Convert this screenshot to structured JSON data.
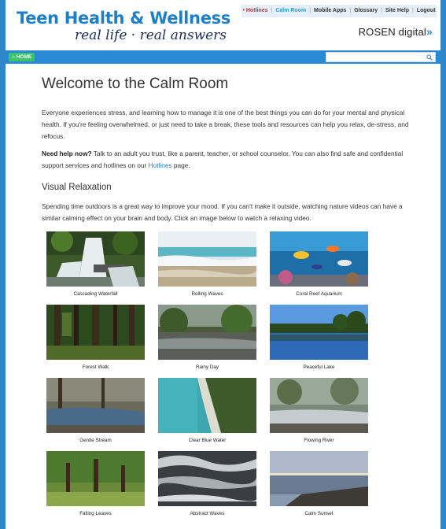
{
  "header": {
    "brand_title": "Teen Health & Wellness",
    "brand_tagline": "real life · real answers",
    "publisher_name": "ROSEN digital",
    "publisher_chevrons": "»",
    "topnav": {
      "hotlines": "• Hotlines",
      "calm_room": "Calm Room",
      "mobile_apps": "Mobile Apps",
      "glossary": "Glossary",
      "site_help": "Site Help",
      "logout": "Logout",
      "separator": "|"
    }
  },
  "navbar": {
    "home_label": "⌂ HOME",
    "search_placeholder": "",
    "search_icon": "search-icon"
  },
  "main": {
    "title": "Welcome to the Calm Room",
    "intro": "Everyone experiences stress, and learning how to manage it is one of the best things you can do for your mental and physical health. If you're feeling overwhelmed, or just need to take a break, these tools and resources can help you relax, de-stress, and refocus.",
    "help_bold": "Need help now?",
    "help_text": " Talk to an adult you trust, like a parent, teacher, or school counselor. You can also find safe and confidential support services and hotlines on our ",
    "help_link": "Hotlines",
    "help_end": " page.",
    "section_title": "Visual Relaxation",
    "section_text": "Spending time outdoors is a great way to improve your mood. If you can't make it outside, watching nature videos can have a similar calming effect on your brain and body. Click an image below to watch a relaxing video.",
    "videos": [
      {
        "caption": "Cascading Waterfall"
      },
      {
        "caption": "Rolling Waves"
      },
      {
        "caption": "Coral Reef Aquarium"
      },
      {
        "caption": "Forest Walk"
      },
      {
        "caption": "Rainy Day"
      },
      {
        "caption": "Peaceful Lake"
      },
      {
        "caption": "Gentle Stream"
      },
      {
        "caption": "Clear Blue Water"
      },
      {
        "caption": "Flowing River"
      },
      {
        "caption": "Falling Leaves"
      },
      {
        "caption": "Abstract Waves"
      },
      {
        "caption": "Calm Sunset"
      }
    ]
  },
  "colors": {
    "page_background": "#2f86c8",
    "brand_blue": "#1f7fc4",
    "navbar_blue": "#2a89d4",
    "home_green": "#3cc46b",
    "hotlines_red": "#d32f2f",
    "link_blue": "#2a7bbf"
  }
}
